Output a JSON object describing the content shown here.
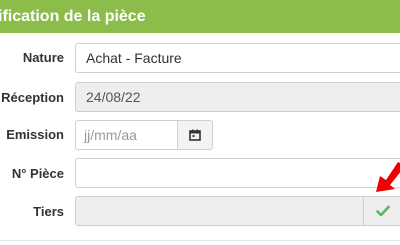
{
  "panel": {
    "title": "ification de la pièce",
    "header_color": "#8cbc4a"
  },
  "fields": {
    "nature": {
      "label": "Nature",
      "value": "Achat - Facture"
    },
    "reception": {
      "label": "Réception",
      "value": "24/08/22"
    },
    "emission": {
      "label": "Emission",
      "placeholder": "jj/mm/aa",
      "icon": "calendar-icon"
    },
    "num_piece": {
      "label": "N° Pièce",
      "value": ""
    },
    "tiers": {
      "label": "Tiers",
      "value": "",
      "icon": "checkmark-icon"
    }
  },
  "colors": {
    "check": "#5cb85c",
    "arrow": "#ee0000"
  }
}
